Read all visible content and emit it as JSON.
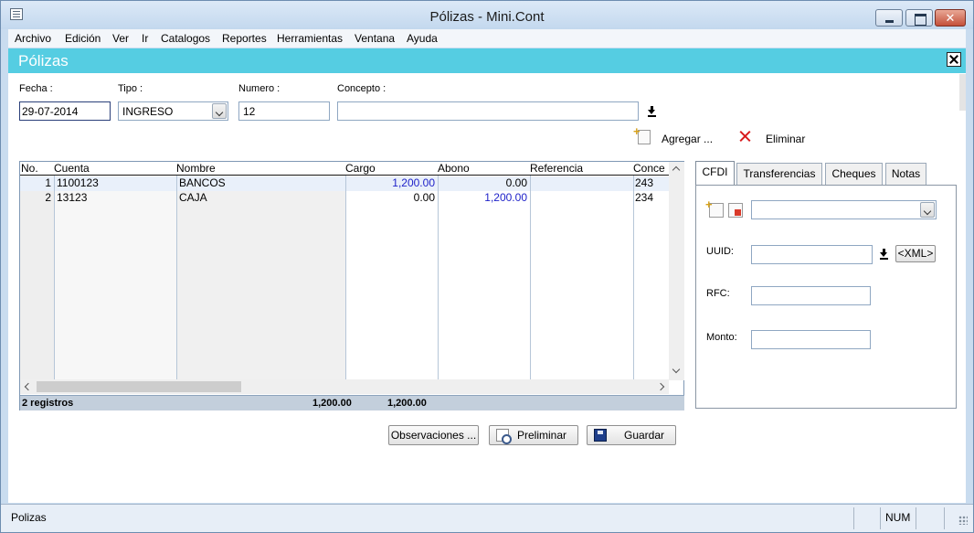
{
  "window": {
    "title": "Pólizas - Mini.Cont"
  },
  "menu": [
    "Archivo",
    "Edición",
    "Ver",
    "Ir",
    "Catalogos",
    "Reportes",
    "Herramientas",
    "Ventana",
    "Ayuda"
  ],
  "header": {
    "title": "Pólizas"
  },
  "form": {
    "fecha_label": "Fecha :",
    "fecha_value": "29-07-2014",
    "tipo_label": "Tipo :",
    "tipo_value": "INGRESO",
    "numero_label": "Numero :",
    "numero_value": "12",
    "concepto_label": "Concepto :",
    "concepto_value": ""
  },
  "actions": {
    "add_label": "Agregar ...",
    "delete_label": "Eliminar"
  },
  "grid": {
    "columns": [
      "No.",
      "Cuenta",
      "Nombre",
      "Cargo",
      "Abono",
      "Referencia",
      "Conce"
    ],
    "rows": [
      {
        "no": "1",
        "cuenta": "1100123",
        "nombre": "BANCOS",
        "cargo": "1,200.00",
        "abono": "0.00",
        "referencia": "",
        "concepto": "243"
      },
      {
        "no": "2",
        "cuenta": "13123",
        "nombre": "CAJA",
        "cargo": "0.00",
        "abono": "1,200.00",
        "referencia": "",
        "concepto": "234"
      }
    ],
    "footer": {
      "count": "2 registros",
      "total_cargo": "1,200.00",
      "total_abono": "1,200.00"
    }
  },
  "tabs": [
    "CFDI",
    "Transferencias",
    "Cheques",
    "Notas"
  ],
  "cfdi": {
    "uuid_label": "UUID:",
    "uuid_value": "",
    "xml_button": "<XML>",
    "rfc_label": "RFC:",
    "rfc_value": "",
    "monto_label": "Monto:",
    "monto_value": ""
  },
  "buttons": {
    "observaciones": "Observaciones ...",
    "preliminar": "Preliminar",
    "guardar": "Guardar"
  },
  "statusbar": {
    "text": "Polizas",
    "num": "NUM"
  },
  "colors": {
    "header": "#55cde2",
    "blue_value": "#1f22c9",
    "delete": "#d9191c"
  },
  "icons": [
    "app-icon",
    "download-icon",
    "add-icon",
    "delete-icon",
    "preview-icon",
    "save-icon",
    "close-icon"
  ]
}
